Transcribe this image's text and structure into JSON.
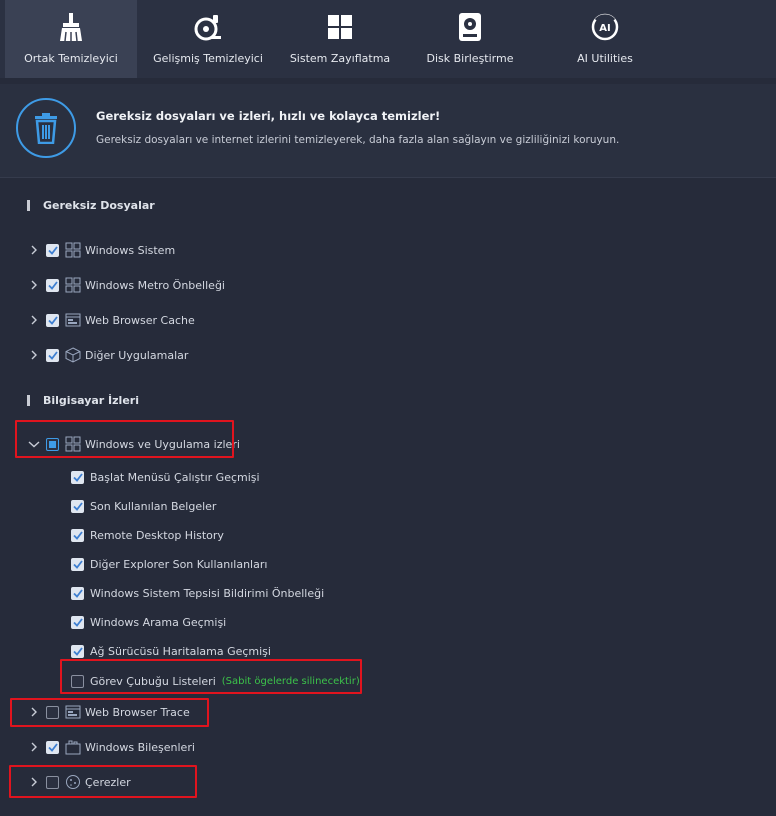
{
  "tabs": [
    {
      "label": "Ortak Temizleyici",
      "icon": "broom-icon",
      "active": true
    },
    {
      "label": "Gelişmiş Temizleyici",
      "icon": "advanced-clean-icon",
      "active": false
    },
    {
      "label": "Sistem Zayıflatma",
      "icon": "windows-icon",
      "active": false
    },
    {
      "label": "Disk Birleştirme",
      "icon": "disk-icon",
      "active": false
    },
    {
      "label": "AI Utilities",
      "icon": "ai-icon",
      "active": false
    }
  ],
  "banner": {
    "title": "Gereksiz dosyaları ve izleri, hızlı ve kolayca temizler!",
    "description": "Gereksiz dosyaları ve internet izlerini temizleyerek, daha fazla alan sağlayın ve gizliliğinizi koruyun.",
    "icon": "trash-icon"
  },
  "sections": {
    "junk_title": "Gereksiz Dosyalar",
    "junk_items": [
      {
        "label": "Windows Sistem",
        "checked": true,
        "icon": "windows-grid-icon"
      },
      {
        "label": "Windows Metro Önbelleği",
        "checked": true,
        "icon": "windows-grid-icon"
      },
      {
        "label": "Web Browser Cache",
        "checked": true,
        "icon": "browser-icon"
      },
      {
        "label": "Diğer Uygulamalar",
        "checked": true,
        "icon": "box-icon"
      }
    ],
    "traces_title": "Bilgisayar İzleri",
    "windows_traces": {
      "label": "Windows ve Uygulama izleri",
      "state": "partial",
      "expanded": true,
      "children": [
        {
          "label": "Başlat Menüsü Çalıştır Geçmişi",
          "checked": true
        },
        {
          "label": "Son Kullanılan Belgeler",
          "checked": true
        },
        {
          "label": "Remote Desktop History",
          "checked": true
        },
        {
          "label": "Diğer Explorer Son Kullanılanları",
          "checked": true
        },
        {
          "label": "Windows Sistem Tepsisi Bildirimi Önbelleği",
          "checked": true
        },
        {
          "label": "Windows Arama Geçmişi",
          "checked": true
        },
        {
          "label": "Ağ Sürücüsü Haritalama Geçmişi",
          "checked": true
        },
        {
          "label": "Görev Çubuğu Listeleri",
          "checked": false,
          "note": "(Sabit ögelerde silinecektir)"
        }
      ]
    },
    "other_items": [
      {
        "label": "Web Browser Trace",
        "checked": false,
        "icon": "browser-icon"
      },
      {
        "label": "Windows Bileşenleri",
        "checked": true,
        "icon": "components-icon"
      },
      {
        "label": "Çerezler",
        "checked": false,
        "icon": "cookie-icon"
      }
    ]
  },
  "colors": {
    "accent": "#3e9be6",
    "highlight": "#e0141e",
    "note": "#3cc24a",
    "background": "#262b3a"
  }
}
